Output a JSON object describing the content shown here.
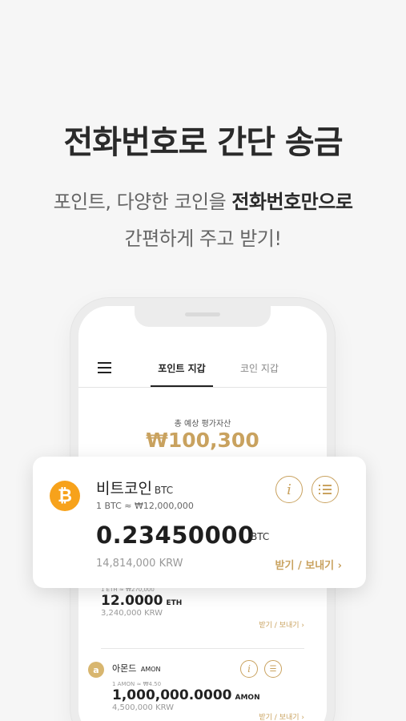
{
  "headline": "전화번호로 간단 송금",
  "subtitle": {
    "line1_prefix": "포인트, 다양한 코인을 ",
    "line1_bold": "전화번호만으로",
    "line2": "간편하게 주고 받기!"
  },
  "app": {
    "tabs": [
      {
        "label": "포인트 지갑",
        "active": true
      },
      {
        "label": "코인 지갑",
        "active": false
      }
    ],
    "total": {
      "label": "총 예상 평가자산",
      "value": "₩100,300"
    },
    "featured_coin": {
      "name": "비트코인",
      "symbol": "BTC",
      "rate": "1 BTC ≈ ₩12,000,000",
      "amount": "0.23450000",
      "amount_unit": "BTC",
      "krw": "14,814,000 KRW",
      "action": "받기 / 보내기 ›",
      "icon": "bitcoin-icon"
    },
    "coins": [
      {
        "name": "",
        "symbol": "ETH",
        "rate": "1 ETH ≈ ₩270,000",
        "amount": "12.0000",
        "amount_unit": "ETH",
        "krw": "3,240,000 KRW",
        "action": "받기 / 보내기 ›"
      },
      {
        "name": "아몬드",
        "symbol": "AMON",
        "rate": "1 AMON ≈ ₩4.50",
        "amount": "1,000,000.0000",
        "amount_unit": "AMON",
        "krw": "4,500,000 KRW",
        "action": "받기 / 보내기 ›"
      }
    ]
  },
  "colors": {
    "accent": "#c9a25f",
    "bitcoin": "#f7a21b",
    "background": "#f6f6f6"
  }
}
